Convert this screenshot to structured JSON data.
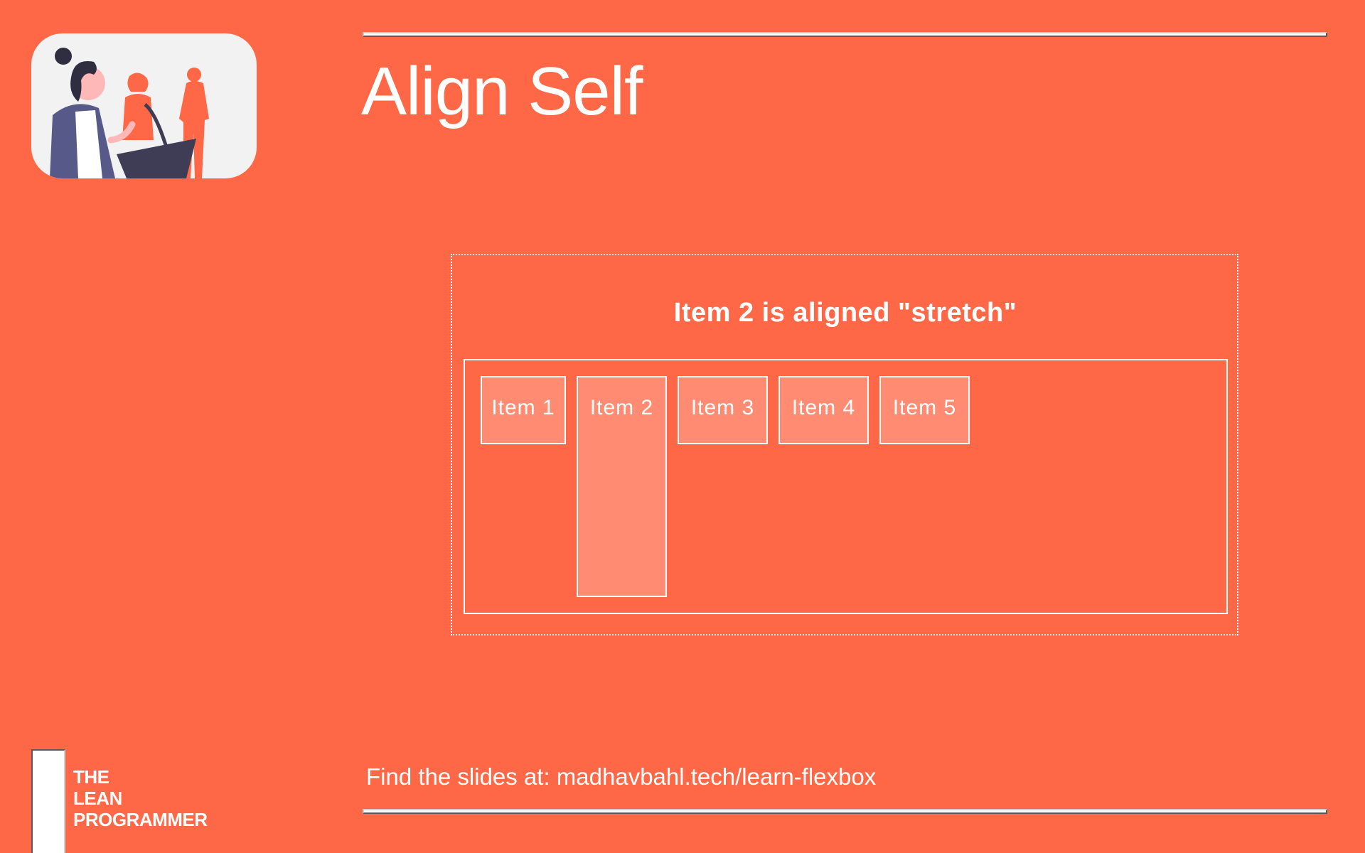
{
  "slide": {
    "title": "Align Self"
  },
  "demo": {
    "caption": "Item 2 is aligned \"stretch\"",
    "items": [
      {
        "label": "Item 1"
      },
      {
        "label": "Item 2",
        "align_self": "stretch"
      },
      {
        "label": "Item 3"
      },
      {
        "label": "Item 4"
      },
      {
        "label": "Item 5"
      }
    ]
  },
  "footer": {
    "slides_link": "Find the slides at: madhavbahl.tech/learn-flexbox"
  },
  "brand": {
    "line1": "THE",
    "line2": "LEAN",
    "line3": "PROGRAMMER"
  },
  "colors": {
    "background": "#FF6846",
    "item_fill": "#FF8B73",
    "text": "#FFFFFF"
  },
  "illustration": "presenter-at-podium"
}
